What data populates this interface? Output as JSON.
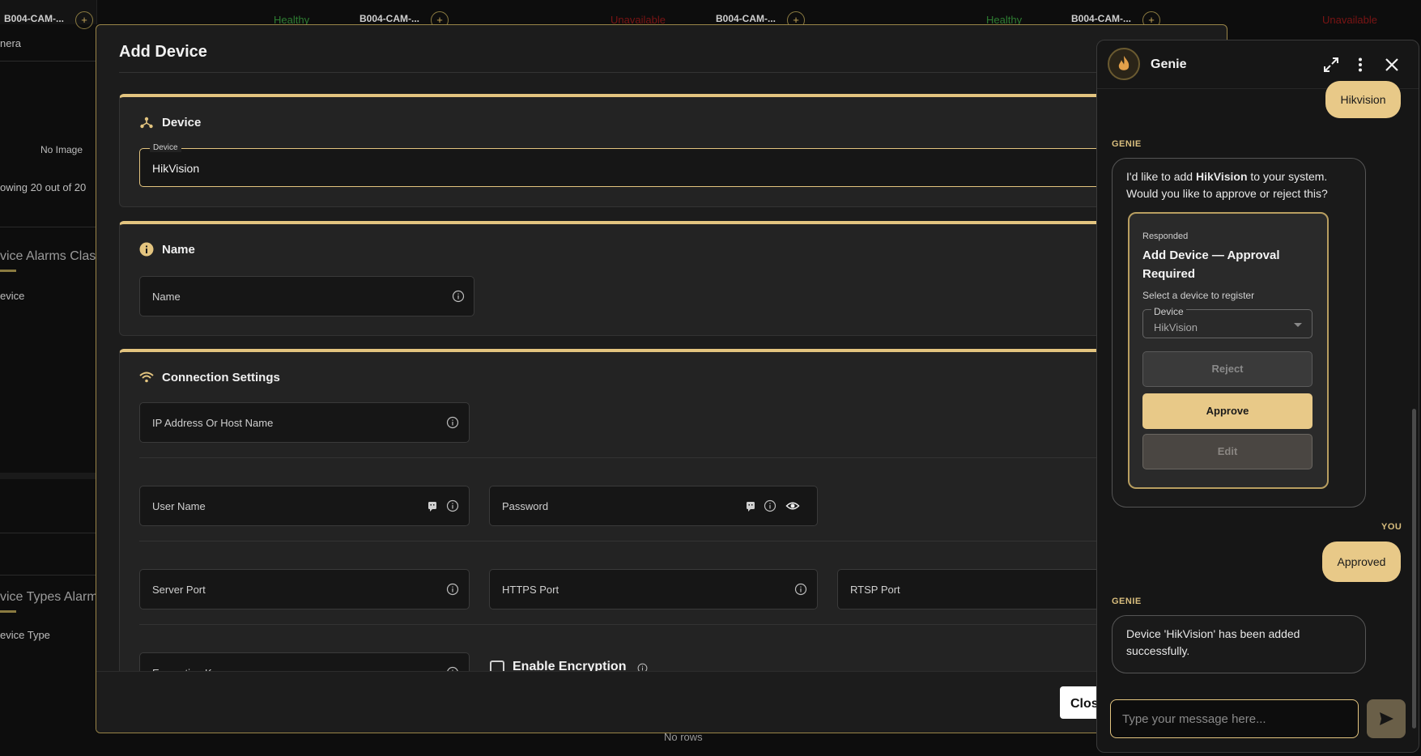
{
  "background": {
    "cards": [
      {
        "name": "B004-CAM-...",
        "status": "Healthy"
      },
      {
        "name": "B004-CAM-...",
        "status": "Unavailable"
      },
      {
        "name": "B004-CAM-...",
        "status": "Healthy"
      },
      {
        "name": "B004-CAM-...",
        "status": "Unavailable"
      }
    ],
    "camera_text": "nera",
    "no_image": "No Image",
    "showing": "owing 20 out of 20",
    "alarms_class_heading": "vice Alarms Class",
    "device_label": "evice",
    "types_alarm_heading": "vice Types Alarm",
    "device_type_label": "evice Type",
    "no_rows": "No rows"
  },
  "modal": {
    "title": "Add Device",
    "device_section": {
      "title": "Device",
      "field_legend": "Device",
      "field_value": "HikVision"
    },
    "name_section": {
      "title": "Name",
      "name_label": "Name"
    },
    "connection_section": {
      "title": "Connection Settings",
      "ip_label": "IP Address Or Host Name",
      "username_label": "User Name",
      "password_label": "Password",
      "server_port_label": "Server Port",
      "https_port_label": "HTTPS Port",
      "rtsp_port_label": "RTSP Port",
      "encryption_key_label": "Encryption Key",
      "enable_encryption_label": "Enable Encryption"
    },
    "close_label": "Clos"
  },
  "genie": {
    "title": "Genie",
    "messages": {
      "user_1": "Hikvision",
      "genie_label": "GENIE",
      "bot_1_prefix": "I'd like to add ",
      "bot_1_bold": "HikVision",
      "bot_1_suffix": " to your system. Would you like to approve or reject this?",
      "card": {
        "status": "Responded",
        "title": "Add Device — Approval Required",
        "subtitle": "Select a device to register",
        "select_legend": "Device",
        "select_value": "HikVision",
        "reject_label": "Reject",
        "approve_label": "Approve",
        "edit_label": "Edit"
      },
      "you_label": "YOU",
      "user_2": "Approved",
      "bot_2": "Device 'HikVision' has been added successfully."
    },
    "input_placeholder": "Type your message here..."
  },
  "colors": {
    "accent": "#e3c47f",
    "user_bubble": "#e8c988",
    "healthy": "#2e7d32",
    "unavailable": "#7a1414"
  }
}
